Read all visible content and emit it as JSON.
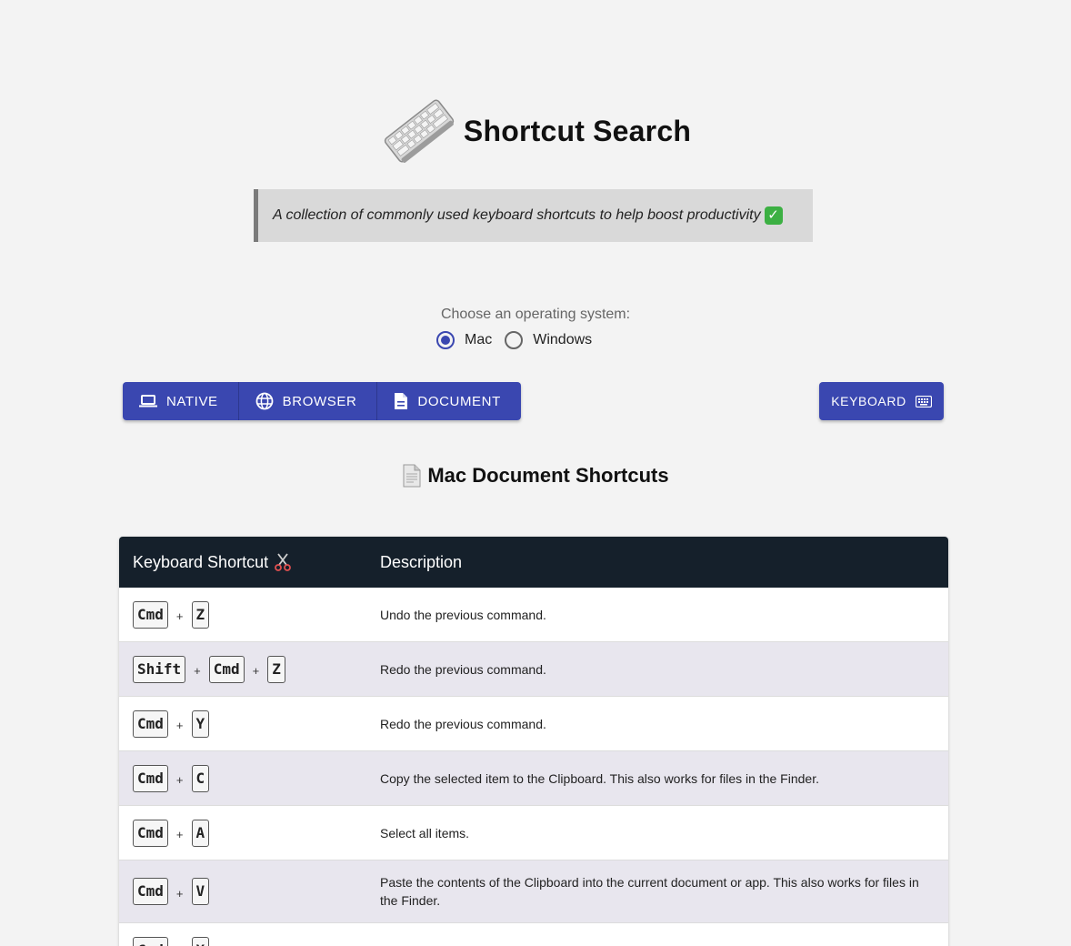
{
  "header": {
    "title": "Shortcut Search",
    "logo_icon": "keyboard-icon"
  },
  "tagline": {
    "text": "A collection of commonly used keyboard shortcuts to help boost productivity",
    "check": "✓"
  },
  "os_picker": {
    "label": "Choose an operating system:",
    "options": [
      {
        "label": "Mac",
        "checked": true
      },
      {
        "label": "Windows",
        "checked": false
      }
    ]
  },
  "category_buttons": [
    {
      "label": "NATIVE",
      "icon": "laptop-icon"
    },
    {
      "label": "BROWSER",
      "icon": "globe-icon"
    },
    {
      "label": "DOCUMENT",
      "icon": "document-icon"
    }
  ],
  "keyboard_button": {
    "label": "KEYBOARD",
    "icon": "keyboard-icon"
  },
  "section": {
    "title": "Mac Document Shortcuts",
    "icon": "document-icon"
  },
  "table": {
    "headers": {
      "shortcut": "Keyboard Shortcut",
      "description": "Description"
    },
    "rows": [
      {
        "keys": [
          "Cmd",
          "Z"
        ],
        "description": "Undo the previous command."
      },
      {
        "keys": [
          "Shift",
          "Cmd",
          "Z"
        ],
        "description": "Redo the previous command."
      },
      {
        "keys": [
          "Cmd",
          "Y"
        ],
        "description": "Redo the previous command."
      },
      {
        "keys": [
          "Cmd",
          "C"
        ],
        "description": "Copy the selected item to the Clipboard. This also works for files in the Finder."
      },
      {
        "keys": [
          "Cmd",
          "A"
        ],
        "description": "Select all items."
      },
      {
        "keys": [
          "Cmd",
          "V"
        ],
        "description": "Paste the contents of the Clipboard into the current document or app. This also works for files in the Finder."
      },
      {
        "keys": [
          "Cmd",
          "X"
        ],
        "description": ""
      }
    ],
    "plus": "+"
  },
  "colors": {
    "accent": "#3a47b0",
    "table_header": "#15202b",
    "alt_row": "#e8e6ee",
    "background": "#f3f3f3"
  }
}
